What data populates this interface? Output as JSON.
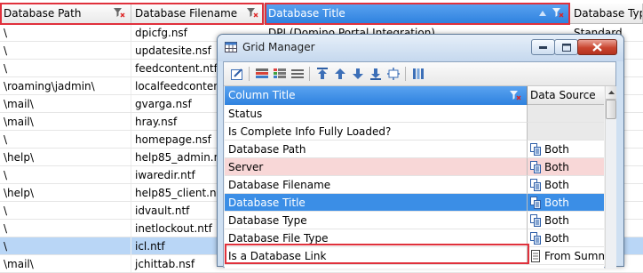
{
  "background_grid": {
    "columns": [
      {
        "label": "Database Path"
      },
      {
        "label": "Database Filename"
      },
      {
        "label": "Database Title"
      },
      {
        "label": "Database Type"
      }
    ],
    "rows": [
      {
        "path": "\\",
        "file": "dpicfg.nsf",
        "title": "DPI (Domino Portal Integration)",
        "type": "Standard"
      },
      {
        "path": "\\",
        "file": "updatesite.nsf",
        "title": "",
        "type": ""
      },
      {
        "path": "\\",
        "file": "feedcontent.ntf",
        "title": "",
        "type": ""
      },
      {
        "path": "\\roaming\\jadmin\\",
        "file": "localfeedcontent",
        "title": "",
        "type": ""
      },
      {
        "path": "\\mail\\",
        "file": "gvarga.nsf",
        "title": "",
        "type": ""
      },
      {
        "path": "\\mail\\",
        "file": "hray.nsf",
        "title": "",
        "type": ""
      },
      {
        "path": "\\",
        "file": "homepage.nsf",
        "title": "",
        "type": ""
      },
      {
        "path": "\\help\\",
        "file": "help85_admin.nsf",
        "title": "",
        "type": ""
      },
      {
        "path": "\\",
        "file": "iwaredir.ntf",
        "title": "",
        "type": ""
      },
      {
        "path": "\\help\\",
        "file": "help85_client.nsf",
        "title": "",
        "type": ""
      },
      {
        "path": "\\",
        "file": "idvault.ntf",
        "title": "",
        "type": ""
      },
      {
        "path": "\\",
        "file": "inetlockout.ntf",
        "title": "",
        "type": ""
      },
      {
        "path": "\\",
        "file": "icl.ntf",
        "title": "",
        "type": ""
      },
      {
        "path": "\\mail\\",
        "file": "jchittab.nsf",
        "title": "",
        "type": ""
      }
    ]
  },
  "dialog": {
    "title": "Grid Manager",
    "icon": "grid-manager-icon",
    "window_buttons": [
      "minimize-icon",
      "maximize-icon",
      "close-icon"
    ],
    "toolbar_icons": [
      "edit-column-icon",
      "columns-list-icon",
      "color-columns-icon",
      "lines-icon",
      "move-first-icon",
      "move-up-icon",
      "move-down-icon",
      "move-last-icon",
      "fit-icon",
      "column-layout-icon"
    ],
    "grid": {
      "columns": {
        "title": "Column Title",
        "source": "Data Source"
      },
      "rows": [
        {
          "title": "Status",
          "source": "",
          "group": true
        },
        {
          "title": "Is Complete Info Fully Loaded?",
          "source": "",
          "group": true
        },
        {
          "title": "Database Path",
          "source": "Both",
          "icon": "both-source-icon"
        },
        {
          "title": "Server",
          "source": "Both",
          "icon": "both-source-icon",
          "highlight": "server"
        },
        {
          "title": "Database Filename",
          "source": "Both",
          "icon": "both-source-icon"
        },
        {
          "title": "Database Title",
          "source": "Both",
          "icon": "both-source-icon",
          "selected": true
        },
        {
          "title": "Database Type",
          "source": "Both",
          "icon": "both-source-icon"
        },
        {
          "title": "Database File Type",
          "source": "Both",
          "icon": "both-source-icon"
        },
        {
          "title": "Is a Database Link",
          "source": "From Summ",
          "icon": "summary-source-icon"
        }
      ]
    }
  },
  "colors": {
    "accent_blue": "#2f82df",
    "highlight_red": "#e0313c",
    "selected_row": "#b9d6f6",
    "server_row": "#f8d7d7"
  }
}
